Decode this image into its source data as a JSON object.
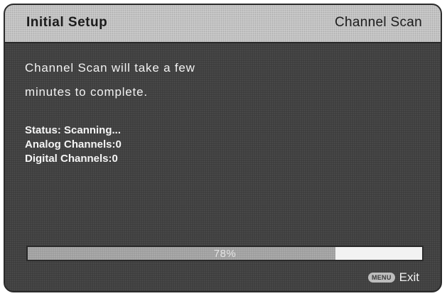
{
  "header": {
    "title": "Initial Setup",
    "section": "Channel Scan"
  },
  "message": {
    "line1": "Channel Scan will take a few",
    "line2": "minutes to complete."
  },
  "status": {
    "state": "Status: Scanning...",
    "analog": "Analog Channels:0",
    "digital": "Digital Channels:0"
  },
  "progress": {
    "value": 0.78,
    "label": "78%"
  },
  "footer": {
    "menu_key": "MENU",
    "exit_label": "Exit"
  }
}
